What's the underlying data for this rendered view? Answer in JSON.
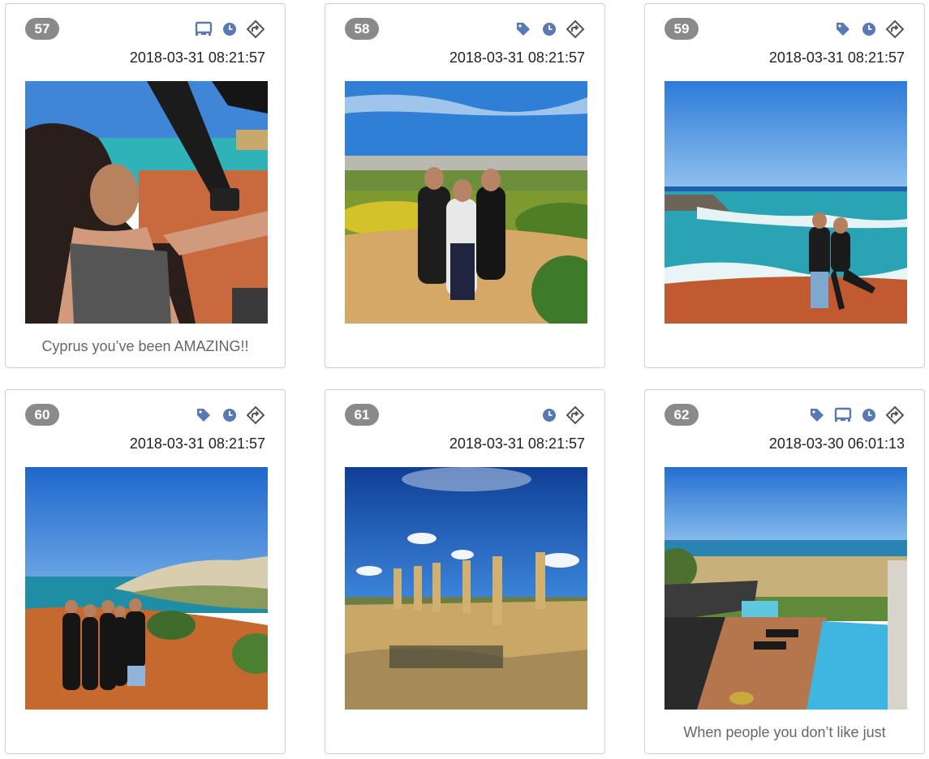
{
  "colors": {
    "badge_bg": "#8a8a8a",
    "icon_blue": "#5a78b4",
    "icon_gray": "#555555"
  },
  "posts": [
    {
      "number": "57",
      "timestamp": "2018-03-31 08:21:57",
      "icons": [
        "device-icon",
        "clock-icon",
        "share-icon"
      ],
      "caption": "Cyprus you’ve been AMAZING!!",
      "photo": "woman-driving-buggy"
    },
    {
      "number": "58",
      "timestamp": "2018-03-31 08:21:57",
      "icons": [
        "tag-icon",
        "clock-icon",
        "share-icon"
      ],
      "caption": "",
      "photo": "three-women-on-path"
    },
    {
      "number": "59",
      "timestamp": "2018-03-31 08:21:57",
      "icons": [
        "tag-icon",
        "clock-icon",
        "share-icon"
      ],
      "caption": "",
      "photo": "couple-on-coast"
    },
    {
      "number": "60",
      "timestamp": "2018-03-31 08:21:57",
      "icons": [
        "tag-icon",
        "clock-icon",
        "share-icon"
      ],
      "caption": "",
      "photo": "group-on-cliff"
    },
    {
      "number": "61",
      "timestamp": "2018-03-31 08:21:57",
      "icons": [
        "clock-icon",
        "share-icon"
      ],
      "caption": "",
      "photo": "ancient-columns"
    },
    {
      "number": "62",
      "timestamp": "2018-03-30 06:01:13",
      "icons": [
        "tag-icon",
        "device-icon",
        "clock-icon",
        "share-icon"
      ],
      "caption": "When people you don’t like just",
      "photo": "villa-pool"
    }
  ]
}
